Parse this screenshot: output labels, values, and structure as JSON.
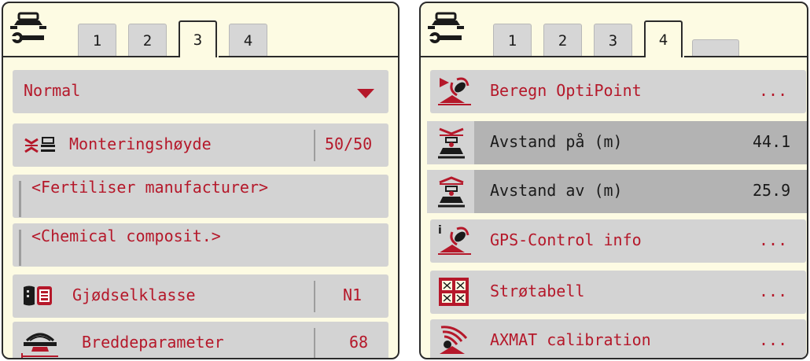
{
  "left_panel": {
    "tabs": [
      {
        "label": "1",
        "active": false
      },
      {
        "label": "2",
        "active": false
      },
      {
        "label": "3",
        "active": true
      },
      {
        "label": "4",
        "active": false
      }
    ],
    "mode_select": {
      "value": "Normal"
    },
    "rows": {
      "mounting_height": {
        "label": "Monteringshøyde",
        "value": "50/50",
        "icon": "mounting-height-icon"
      },
      "fertiliser_manufacturer": {
        "value": "<Fertiliser manufacturer>"
      },
      "chemical_composition": {
        "value": "<Chemical composit.>"
      },
      "fertiliser_class": {
        "label": "Gjødselklasse",
        "value": "N1",
        "icon": "fertiliser-class-icon"
      },
      "width_parameter": {
        "label": "Breddeparameter",
        "value": "68",
        "icon": "width-parameter-icon"
      }
    }
  },
  "right_panel": {
    "tabs": [
      {
        "label": "1",
        "active": false
      },
      {
        "label": "2",
        "active": false
      },
      {
        "label": "3",
        "active": false
      },
      {
        "label": "4",
        "active": true
      }
    ],
    "rows": {
      "calculate_optipoint": {
        "label": "Beregn OptiPoint",
        "value": "...",
        "icon": "optipoint-icon"
      },
      "distance_on": {
        "label": "Avstand på (m)",
        "value": "44.1",
        "icon": "distance-on-icon"
      },
      "distance_off": {
        "label": "Avstand av (m)",
        "value": "25.9",
        "icon": "distance-off-icon"
      },
      "gps_control_info": {
        "label": "GPS-Control info",
        "value": "...",
        "icon": "gps-info-icon"
      },
      "spread_chart": {
        "label": "Strøtabell",
        "value": "...",
        "icon": "spread-table-icon"
      },
      "axmat_calibration": {
        "label": "AXMAT calibration",
        "value": "...",
        "icon": "axmat-icon"
      }
    }
  },
  "colors": {
    "panel_bg": "#fdfbe3",
    "row_bg": "#d3d3d3",
    "row_selected_bg": "#b3b3b3",
    "text_red": "#b5182a",
    "border": "#2b2b2b"
  }
}
